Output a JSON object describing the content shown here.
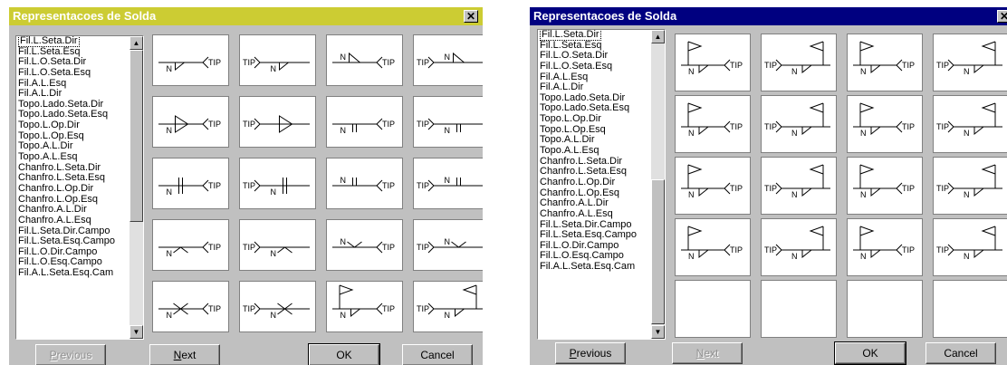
{
  "dialogs": [
    {
      "title": "Representacoes de Solda",
      "close_glyph": "✕",
      "list_items": [
        "Fil.L.Seta.Dir",
        "Fil.L.Seta.Esq",
        "Fil.L.O.Seta.Dir",
        "Fil.L.O.Seta.Esq",
        "Fil.A.L.Esq",
        "Fil.A.L.Dir",
        "Topo.Lado.Seta.Dir",
        "Topo.Lado.Seta.Esq",
        "Topo.L.Op.Dir",
        "Topo.L.Op.Esq",
        "Topo.A.L.Dir",
        "Topo.A.L.Esq",
        "Chanfro.L.Seta.Dir",
        "Chanfro.L.Seta.Esq",
        "Chanfro.L.Op.Dir",
        "Chanfro.L.Op.Esq",
        "Chanfro.A.L.Dir",
        "Chanfro.A.L.Esq",
        "Fil.L.Seta.Dir.Campo",
        "Fil.L.Seta.Esq.Campo",
        "Fil.L.O.Dir.Campo",
        "Fil.L.O.Esq.Campo",
        "Fil.A.L.Seta.Esq.Cam"
      ],
      "selected_item": "Fil.L.Seta.Dir",
      "cells": [
        {
          "icon": "weld-fillet-arrow-side-right-icon",
          "n": "N",
          "tip": "TIP"
        },
        {
          "icon": "weld-fillet-arrow-side-left-icon",
          "n": "N",
          "tip": "TIP"
        },
        {
          "icon": "weld-fillet-other-side-right-icon",
          "n": "N",
          "tip": "TIP"
        },
        {
          "icon": "weld-fillet-other-side-left-icon",
          "n": "N",
          "tip": "TIP"
        },
        {
          "icon": "weld-fillet-both-sides-left-icon",
          "n": "N",
          "tip": "TIP"
        },
        {
          "icon": "weld-fillet-both-sides-right-icon",
          "n": "",
          "tip": "TIP"
        },
        {
          "icon": "weld-square-arrow-side-right-icon",
          "n": "N",
          "tip": "TIP"
        },
        {
          "icon": "weld-square-arrow-side-left-icon",
          "n": "N",
          "tip": "TIP"
        },
        {
          "icon": "weld-square-other-side-right-icon",
          "n": "N",
          "tip": "TIP"
        },
        {
          "icon": "weld-square-other-side-left-icon",
          "n": "N",
          "tip": "TIP"
        },
        {
          "icon": "weld-square-both-sides-right-icon",
          "n": "N",
          "tip": "TIP"
        },
        {
          "icon": "weld-square-both-sides-left-icon",
          "n": "N",
          "tip": "TIP"
        },
        {
          "icon": "weld-bevel-arrow-side-right-icon",
          "n": "N",
          "tip": "TIP"
        },
        {
          "icon": "weld-bevel-arrow-side-left-icon",
          "n": "N",
          "tip": "TIP"
        },
        {
          "icon": "weld-bevel-other-side-right-icon",
          "n": "N",
          "tip": "TIP"
        },
        {
          "icon": "weld-bevel-other-side-left-icon",
          "n": "N",
          "tip": "TIP"
        },
        {
          "icon": "weld-bevel-both-sides-right-icon",
          "n": "N",
          "tip": "TIP"
        },
        {
          "icon": "weld-bevel-both-sides-left-icon",
          "n": "N",
          "tip": "TIP"
        },
        {
          "icon": "weld-field-fillet-right-icon",
          "n": "N",
          "tip": "TIP"
        },
        {
          "icon": "weld-field-fillet-left-icon",
          "n": "N",
          "tip": "TIP"
        }
      ],
      "buttons": {
        "previous": "Previous",
        "next": "Next",
        "ok": "OK",
        "cancel": "Cancel"
      },
      "button_state": {
        "previous": "disabled",
        "next": "enabled"
      }
    },
    {
      "title": "Representacoes de Solda",
      "close_glyph": "✕",
      "list_items": [
        "Fil.L.Seta.Dir",
        "Fil.L.Seta.Esq",
        "Fil.L.O.Seta.Dir",
        "Fil.L.O.Seta.Esq",
        "Fil.A.L.Esq",
        "Fil.A.L.Dir",
        "Topo.Lado.Seta.Dir",
        "Topo.Lado.Seta.Esq",
        "Topo.L.Op.Dir",
        "Topo.L.Op.Esq",
        "Topo.A.L.Dir",
        "Topo.A.L.Esq",
        "Chanfro.L.Seta.Dir",
        "Chanfro.L.Seta.Esq",
        "Chanfro.L.Op.Dir",
        "Chanfro.L.Op.Esq",
        "Chanfro.A.L.Dir",
        "Chanfro.A.L.Esq",
        "Fil.L.Seta.Dir.Campo",
        "Fil.L.Seta.Esq.Campo",
        "Fil.L.O.Dir.Campo",
        "Fil.L.O.Esq.Campo",
        "Fil.A.L.Seta.Esq.Cam"
      ],
      "selected_item": "Fil.L.Seta.Dir",
      "cells": [
        {
          "icon": "weld-field-fillet-arrow-side-right-icon",
          "n": "N",
          "tip": "TIP"
        },
        {
          "icon": "weld-field-fillet-other-side-left-icon",
          "n": "N",
          "tip": "TIP"
        },
        {
          "icon": "weld-field-fillet-both-sides-left-icon",
          "n": "N",
          "tip": "TIP"
        },
        {
          "icon": "weld-field-fillet-both-sides-right-icon",
          "n": "N",
          "tip": "TIP"
        },
        {
          "icon": "weld-field-square-arrow-side-right-icon",
          "n": "N",
          "tip": "TIP"
        },
        {
          "icon": "weld-field-square-arrow-side-left-icon",
          "n": "N",
          "tip": "TIP"
        },
        {
          "icon": "weld-field-square-other-side-right-icon",
          "n": "N",
          "tip": "TIP"
        },
        {
          "icon": "weld-field-square-other-side-left-icon",
          "n": "N",
          "tip": "TIP"
        },
        {
          "icon": "weld-field-square-both-sides-right-icon",
          "n": "N",
          "tip": "TIP"
        },
        {
          "icon": "weld-field-square-both-sides-left-icon",
          "n": "N",
          "tip": "TIP"
        },
        {
          "icon": "weld-field-bevel-arrow-side-right-icon",
          "n": "N",
          "tip": "TIP"
        },
        {
          "icon": "weld-field-bevel-arrow-side-left-icon",
          "n": "N",
          "tip": "TIP"
        },
        {
          "icon": "weld-field-bevel-other-side-right-icon",
          "n": "N",
          "tip": "TIP"
        },
        {
          "icon": "weld-field-bevel-other-side-left-icon",
          "n": "N",
          "tip": "TIP"
        },
        {
          "icon": "weld-field-bevel-both-sides-right-icon",
          "n": "N",
          "tip": "TIP"
        },
        {
          "icon": "weld-field-bevel-both-sides-left-icon",
          "n": "N",
          "tip": "TIP"
        },
        {
          "icon": "empty-slot-icon",
          "n": "",
          "tip": ""
        },
        {
          "icon": "empty-slot-icon",
          "n": "",
          "tip": ""
        },
        {
          "icon": "empty-slot-icon",
          "n": "",
          "tip": ""
        },
        {
          "icon": "empty-slot-icon",
          "n": "",
          "tip": ""
        }
      ],
      "buttons": {
        "previous": "Previous",
        "next": "Next",
        "ok": "OK",
        "cancel": "Cancel"
      },
      "button_state": {
        "previous": "enabled",
        "next": "disabled"
      }
    }
  ]
}
